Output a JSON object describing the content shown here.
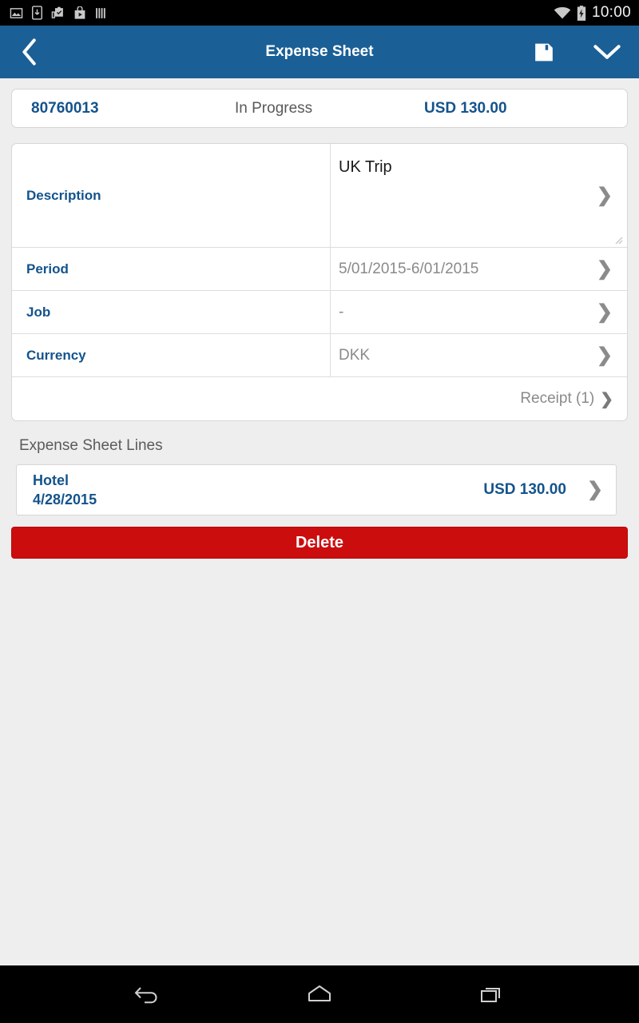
{
  "statusbar": {
    "time": "10:00",
    "left_icons": [
      "image-icon",
      "download-to-device-icon",
      "clipboard-check-icon",
      "play-store-bag-icon",
      "barcode-icon"
    ],
    "right_icons": [
      "wifi-icon",
      "battery-charging-icon"
    ]
  },
  "header": {
    "title": "Expense Sheet",
    "back_icon": "chevron-left-icon",
    "save_icon": "save-floppy-icon",
    "more_icon": "chevron-down-icon"
  },
  "summary": {
    "id": "80760013",
    "status": "In Progress",
    "amount": "USD 130.00"
  },
  "form": {
    "rows": [
      {
        "label": "Description",
        "value": "UK Trip",
        "chevron": "chevron-right-icon"
      },
      {
        "label": "Period",
        "value": "5/01/2015-6/01/2015",
        "chevron": "chevron-right-icon"
      },
      {
        "label": "Job",
        "value": "-",
        "chevron": "chevron-right-icon"
      },
      {
        "label": "Currency",
        "value": "DKK",
        "chevron": "chevron-right-icon"
      }
    ],
    "receipt": {
      "label": "Receipt (1)",
      "chevron": "chevron-right-icon"
    }
  },
  "lines_section": {
    "title": "Expense Sheet Lines",
    "lines": [
      {
        "title": "Hotel",
        "date": "4/28/2015",
        "amount": "USD 130.00",
        "chevron": "chevron-right-icon"
      }
    ]
  },
  "actions": {
    "delete_label": "Delete"
  },
  "navbar": {
    "back_icon": "android-back-icon",
    "home_icon": "android-home-icon",
    "recents_icon": "android-recents-icon"
  },
  "colors": {
    "header_blue": "#1a5f96",
    "label_blue": "#14538c",
    "delete_red": "#cc0d0d",
    "page_background": "#eeeeee",
    "muted_text": "#8a8a8a"
  }
}
